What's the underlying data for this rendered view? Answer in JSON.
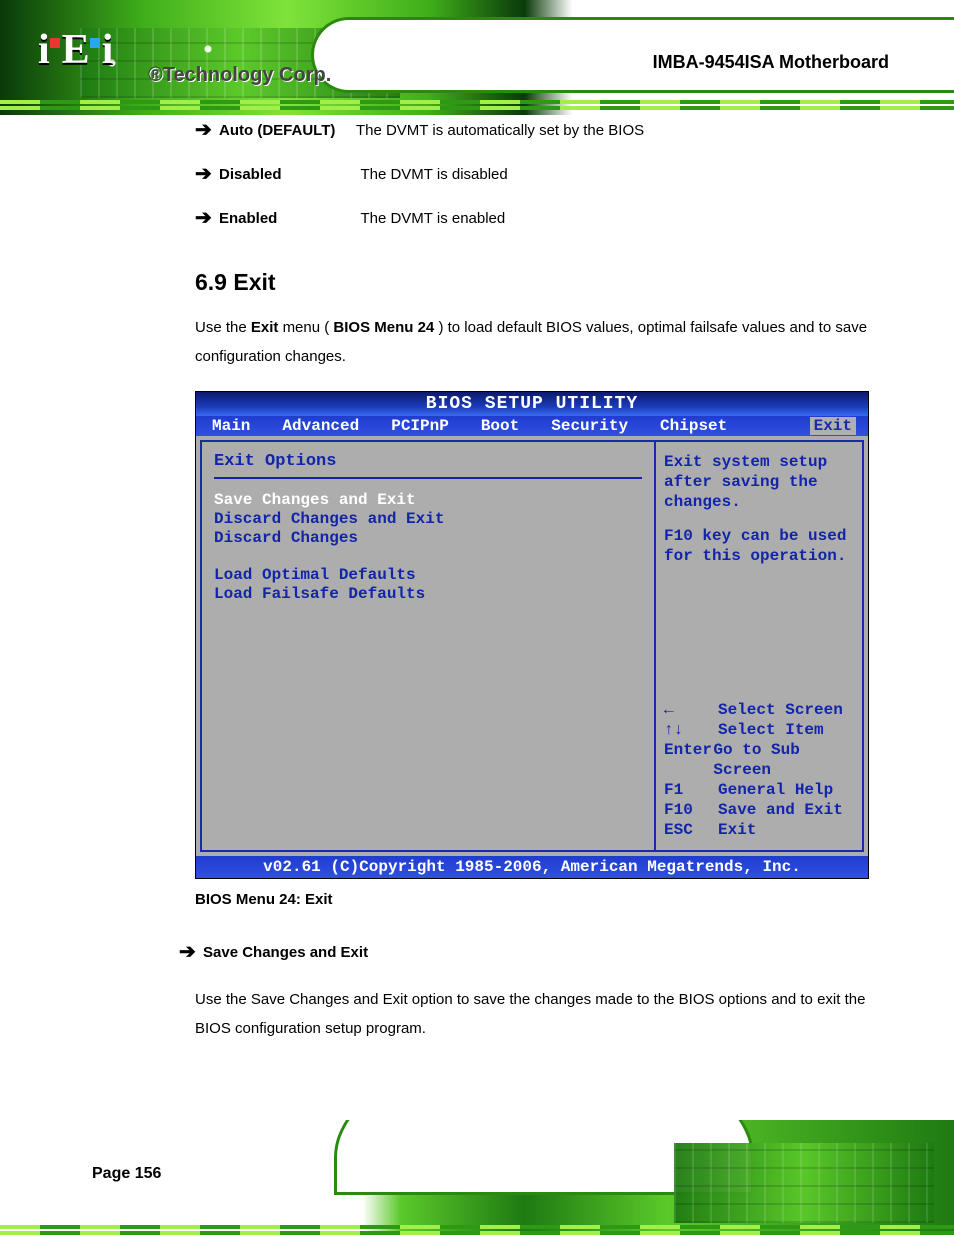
{
  "header": {
    "logo_text": "iEi",
    "brand_suffix": "®Technology Corp.",
    "product_title": "IMBA-9454ISA Motherboard"
  },
  "bullets": [
    {
      "lead": "Auto (DEFAULT)",
      "rest": "The DVMT is automatically set by the BIOS"
    },
    {
      "lead": "Disabled",
      "rest": "The DVMT is disabled"
    },
    {
      "lead": "Enabled",
      "rest": "The DVMT is enabled"
    }
  ],
  "section": {
    "number": "6.9",
    "title": "Exit",
    "para_pre": "Use the ",
    "menu_name": "Exit",
    "para_mid": " menu (",
    "bios_menu_ref": "BIOS Menu 24",
    "para_post": ") to load default BIOS values, optimal failsafe values and to save configuration changes."
  },
  "bios": {
    "title": "BIOS SETUP UTILITY",
    "tabs": [
      "Main",
      "Advanced",
      "PCIPnP",
      "Boot",
      "Security",
      "Chipset",
      "Exit"
    ],
    "selected_tab": "Exit",
    "left": {
      "heading": "Exit Options",
      "items": [
        {
          "label": "Save Changes and Exit",
          "selected": true
        },
        {
          "label": "Discard Changes and Exit",
          "selected": false
        },
        {
          "label": "Discard Changes",
          "selected": false
        }
      ],
      "items2": [
        {
          "label": "Load Optimal Defaults",
          "selected": false
        },
        {
          "label": "Load Failsafe Defaults",
          "selected": false
        }
      ]
    },
    "right": {
      "help1": "Exit system setup after saving the changes.",
      "help2": "F10 key can be used for this operation.",
      "keys": [
        {
          "k": "←",
          "d": "Select Screen"
        },
        {
          "k": "↑↓",
          "d": "Select Item"
        },
        {
          "k": "Enter",
          "d": "Go to Sub Screen"
        },
        {
          "k": "F1",
          "d": "General Help"
        },
        {
          "k": "F10",
          "d": "Save and Exit"
        },
        {
          "k": "ESC",
          "d": "Exit"
        }
      ]
    },
    "footer": "v02.61 (C)Copyright 1985-2006, American Megatrends, Inc."
  },
  "figure_caption": "BIOS Menu 24: Exit",
  "save_section": {
    "arrow": "➔",
    "title": "Save Changes and Exit",
    "para": "Use the Save Changes and Exit option to save the changes made to the BIOS options and to exit the BIOS configuration setup program."
  },
  "page_number": "Page 156"
}
